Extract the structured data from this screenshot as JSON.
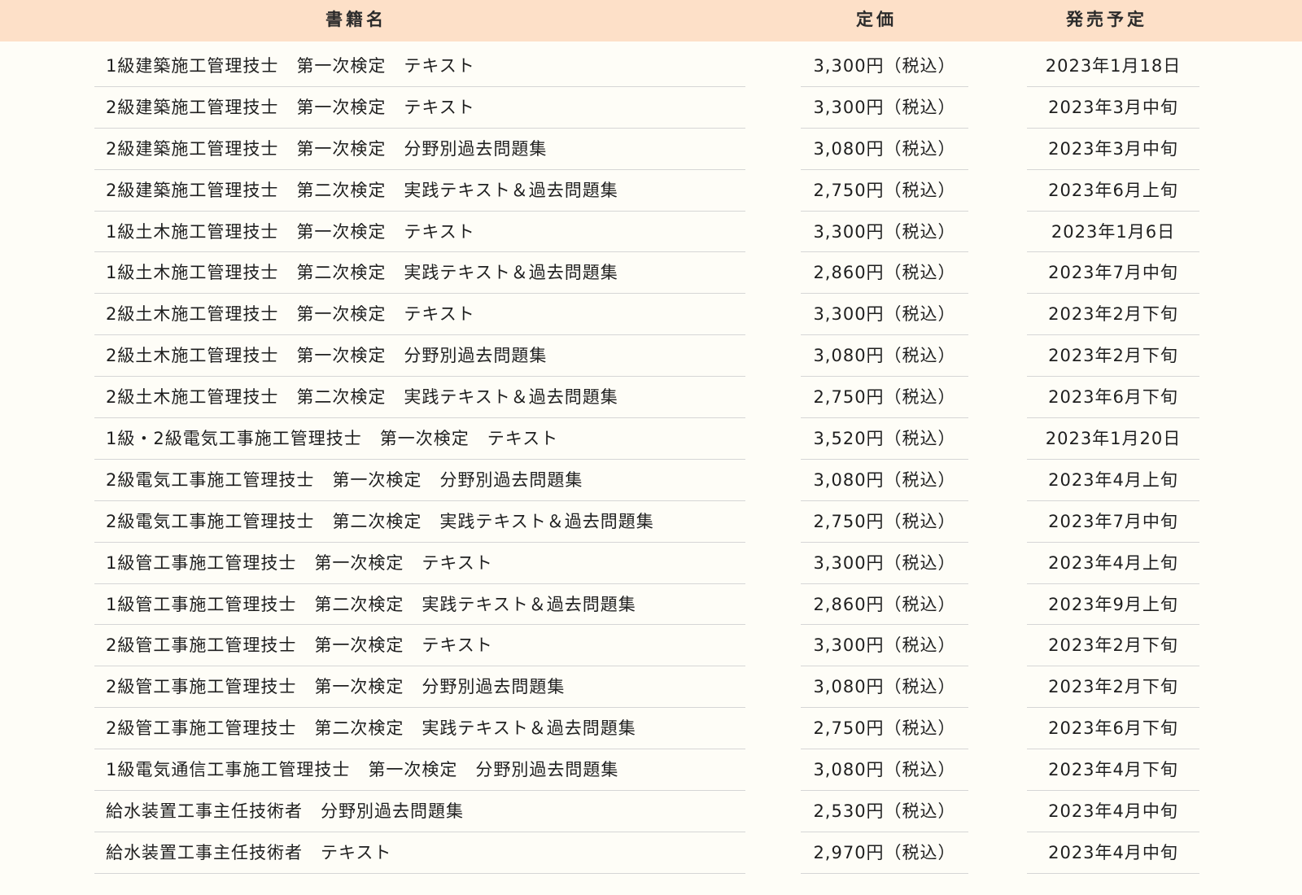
{
  "table": {
    "headers": {
      "title": "書籍名",
      "price": "定価",
      "release": "発売予定"
    },
    "rows": [
      {
        "title": "1級建築施工管理技士　第一次検定　テキスト",
        "price": "3,300円（税込）",
        "release": "2023年1月18日"
      },
      {
        "title": "2級建築施工管理技士　第一次検定　テキスト",
        "price": "3,300円（税込）",
        "release": "2023年3月中旬"
      },
      {
        "title": "2級建築施工管理技士　第一次検定　分野別過去問題集",
        "price": "3,080円（税込）",
        "release": "2023年3月中旬"
      },
      {
        "title": "2級建築施工管理技士　第二次検定　実践テキスト＆過去問題集",
        "price": "2,750円（税込）",
        "release": "2023年6月上旬"
      },
      {
        "title": "1級土木施工管理技士　第一次検定　テキスト",
        "price": "3,300円（税込）",
        "release": "2023年1月6日"
      },
      {
        "title": "1級土木施工管理技士　第二次検定　実践テキスト＆過去問題集",
        "price": "2,860円（税込）",
        "release": "2023年7月中旬"
      },
      {
        "title": "2級土木施工管理技士　第一次検定　テキスト",
        "price": "3,300円（税込）",
        "release": "2023年2月下旬"
      },
      {
        "title": "2級土木施工管理技士　第一次検定　分野別過去問題集",
        "price": "3,080円（税込）",
        "release": "2023年2月下旬"
      },
      {
        "title": "2級土木施工管理技士　第二次検定　実践テキスト＆過去問題集",
        "price": "2,750円（税込）",
        "release": "2023年6月下旬"
      },
      {
        "title": "1級・2級電気工事施工管理技士　第一次検定　テキスト",
        "price": "3,520円（税込）",
        "release": "2023年1月20日"
      },
      {
        "title": "2級電気工事施工管理技士　第一次検定　分野別過去問題集",
        "price": "3,080円（税込）",
        "release": "2023年4月上旬"
      },
      {
        "title": "2級電気工事施工管理技士　第二次検定　実践テキスト＆過去問題集",
        "price": "2,750円（税込）",
        "release": "2023年7月中旬"
      },
      {
        "title": "1級管工事施工管理技士　第一次検定　テキスト",
        "price": "3,300円（税込）",
        "release": "2023年4月上旬"
      },
      {
        "title": "1級管工事施工管理技士　第二次検定　実践テキスト＆過去問題集",
        "price": "2,860円（税込）",
        "release": "2023年9月上旬"
      },
      {
        "title": "2級管工事施工管理技士　第一次検定　テキスト",
        "price": "3,300円（税込）",
        "release": "2023年2月下旬"
      },
      {
        "title": "2級管工事施工管理技士　第一次検定　分野別過去問題集",
        "price": "3,080円（税込）",
        "release": "2023年2月下旬"
      },
      {
        "title": "2級管工事施工管理技士　第二次検定　実践テキスト＆過去問題集",
        "price": "2,750円（税込）",
        "release": "2023年6月下旬"
      },
      {
        "title": "1級電気通信工事施工管理技士　第一次検定　分野別過去問題集",
        "price": "3,080円（税込）",
        "release": "2023年4月下旬"
      },
      {
        "title": "給水装置工事主任技術者　分野別過去問題集",
        "price": "2,530円（税込）",
        "release": "2023年4月中旬"
      },
      {
        "title": "給水装置工事主任技術者　テキスト",
        "price": "2,970円（税込）",
        "release": "2023年4月中旬"
      }
    ]
  },
  "colors": {
    "header_bg": "#fde0c8",
    "page_bg": "#fefdf7",
    "row_divider": "#d6d6d6",
    "text": "#1f1f1f"
  }
}
